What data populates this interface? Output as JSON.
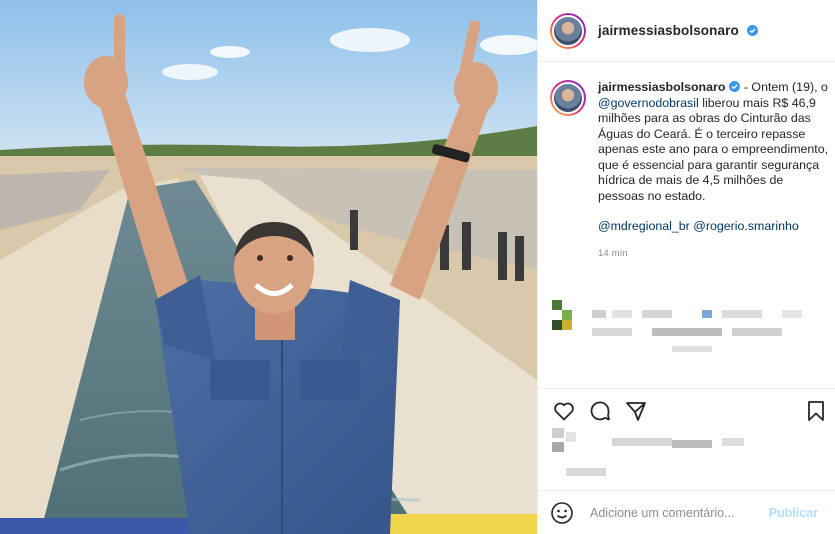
{
  "header": {
    "username": "jairmessiasbolsonaro",
    "verified": true
  },
  "caption": {
    "username": "jairmessiasbolsonaro",
    "lead": "- Ontem (19), o",
    "mention1": "@governodobrasil",
    "body": "liberou mais R$ 46,9 milhões para as obras do Cinturão das Águas do Ceará. É o terceiro repasse apenas este ano para o empreendimento, que é essencial para garantir segurança hídrica de mais de 4,5 milhões de pessoas no estado.",
    "mention2": "@mdregional_br",
    "mention3": "@rogerio.smarinho",
    "time": "14 min"
  },
  "comment": {
    "placeholder": "Adicione um comentário...",
    "post_label": "Publicar"
  },
  "icons": {
    "like": "heart-icon",
    "comment": "comment-icon",
    "share": "send-icon",
    "save": "bookmark-icon",
    "emoji": "emoji-icon",
    "verified": "verified-badge-icon"
  },
  "colors": {
    "link": "#00376b",
    "verified": "#3897f0",
    "post_disabled": "#b2dffc",
    "muted": "#8e8e8e"
  }
}
